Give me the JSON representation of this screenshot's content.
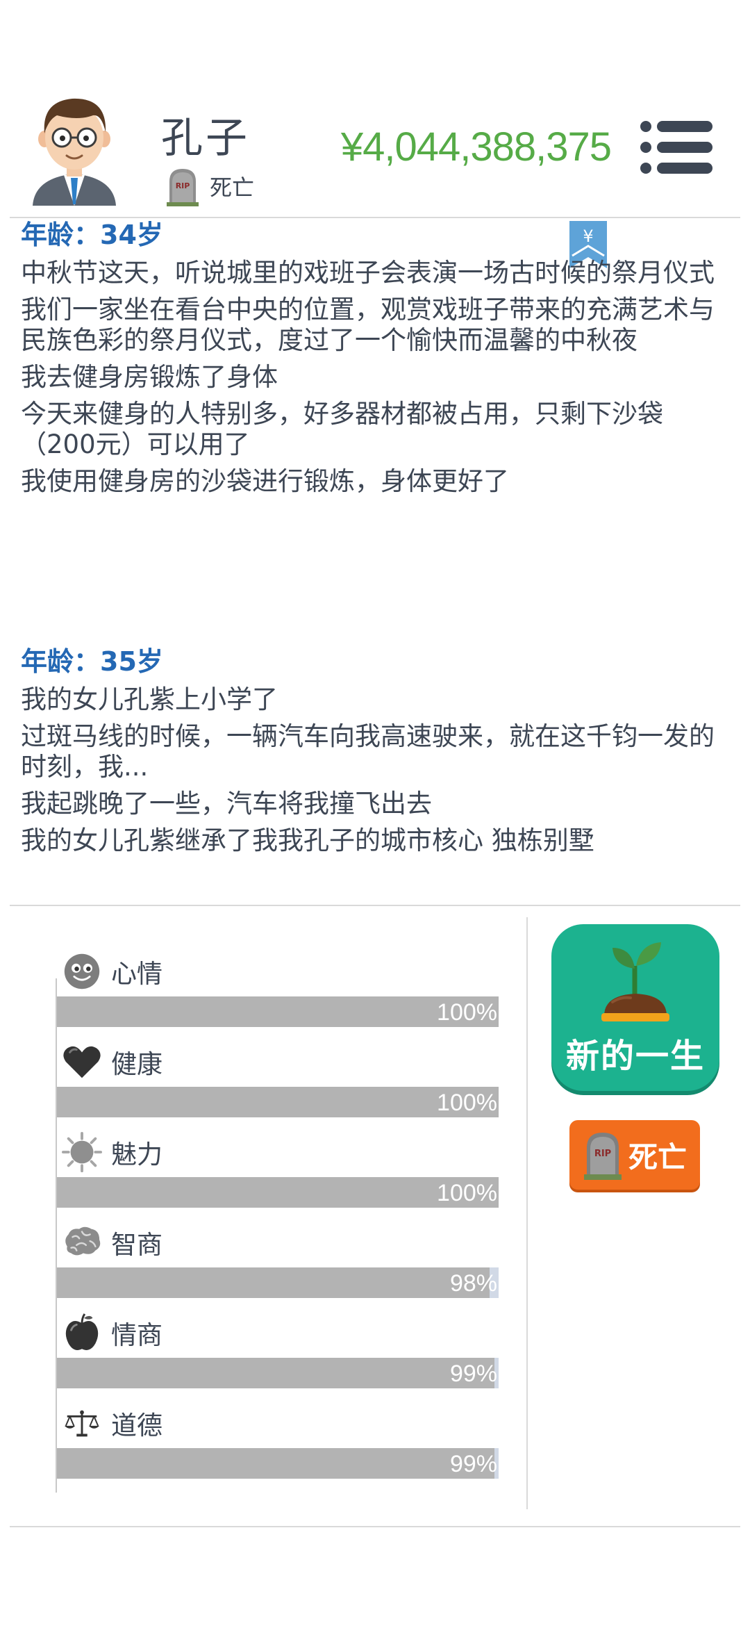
{
  "header": {
    "name": "孔子",
    "status": "死亡",
    "money": "¥4,044,388,375",
    "avatar_icon": "businessman-avatar-icon",
    "status_icon": "tombstone-rip-icon",
    "menu_icon": "menu-list-icon",
    "money_color": "#56ab47"
  },
  "bookmark": {
    "symbol": "¥",
    "icon": "yen-bookmark-icon"
  },
  "log": [
    {
      "age": "年龄：34岁",
      "entries": [
        "中秋节这天，听说城里的戏班子会表演一场古时候的祭月仪式",
        "我们一家坐在看台中央的位置，观赏戏班子带来的充满艺术与民族色彩的祭月仪式，度过了一个愉快而温馨的中秋夜",
        "我去健身房锻炼了身体",
        "今天来健身的人特别多，好多器材都被占用，只剩下沙袋（200元）可以用了",
        "我使用健身房的沙袋进行锻炼，身体更好了"
      ]
    },
    {
      "age": "年龄：35岁",
      "entries": [
        "我的女儿孔紫上小学了",
        "过斑马线的时候，一辆汽车向我高速驶来，就在这千钧一发的时刻，我...",
        "我起跳晚了一些，汽车将我撞飞出去",
        "我的女儿孔紫继承了我我孔子的城市核心 独栋别墅"
      ]
    }
  ],
  "stats": [
    {
      "label": "心情",
      "value": 100,
      "text": "100%",
      "icon": "smiley-face-icon"
    },
    {
      "label": "健康",
      "value": 100,
      "text": "100%",
      "icon": "heart-icon"
    },
    {
      "label": "魅力",
      "value": 100,
      "text": "100%",
      "icon": "sun-icon"
    },
    {
      "label": "智商",
      "value": 98,
      "text": "98%",
      "icon": "brain-icon"
    },
    {
      "label": "情商",
      "value": 99,
      "text": "99%",
      "icon": "apple-icon"
    },
    {
      "label": "道德",
      "value": 99,
      "text": "99%",
      "icon": "scales-icon"
    }
  ],
  "actions": {
    "new_life": "新的一生",
    "new_life_icon": "sprout-icon",
    "dead": "死亡",
    "dead_icon": "tombstone-rip-icon",
    "new_life_color": "#1cb28f",
    "dead_color": "#f26d1d"
  },
  "colors": {
    "age_heading": "#2468b4",
    "text": "#3d4654",
    "bar_fill": "#b3b3b3",
    "bar_track": "#d1d9e6"
  }
}
